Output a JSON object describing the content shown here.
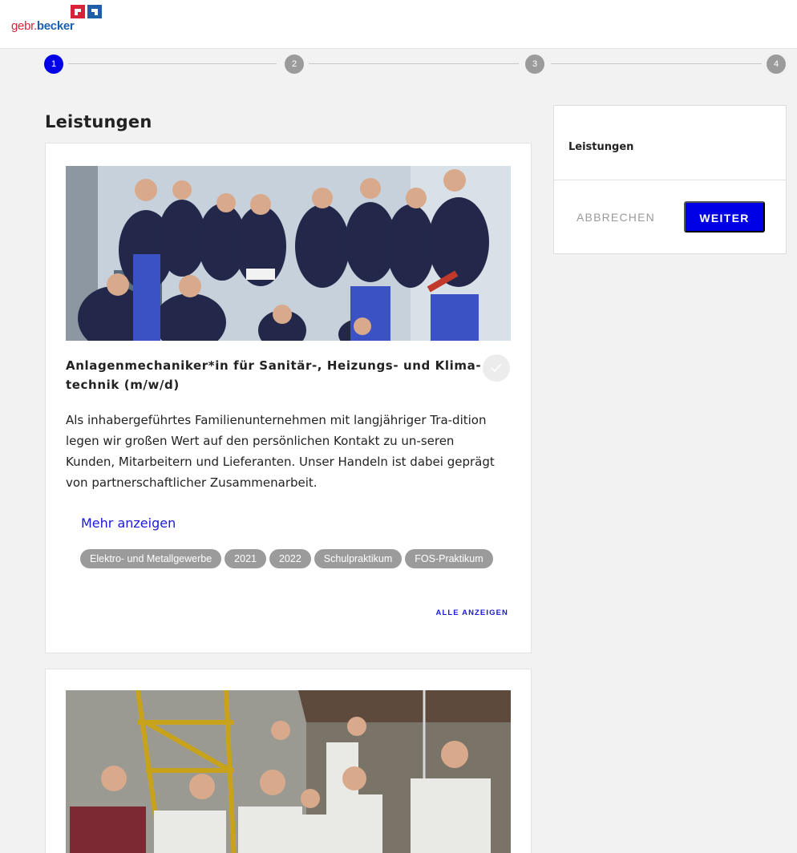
{
  "brand": {
    "name_prefix": "gebr.",
    "name_main": "becker",
    "colors": {
      "red": "#d6233a",
      "blue": "#1f5fa8"
    }
  },
  "stepper": {
    "steps": [
      {
        "label": "1",
        "active": true
      },
      {
        "label": "2",
        "active": false
      },
      {
        "label": "3",
        "active": false
      },
      {
        "label": "4",
        "active": false
      }
    ]
  },
  "main": {
    "title": "Leistungen",
    "cards": [
      {
        "image": "team-photo-workshop",
        "title": "Anlagenmechaniker*in für Sanitär-, Heizungs- und Klima-technik (m/w/d)",
        "description": "Als inhabergeführtes Familienunternehmen mit langjähriger Tra-dition legen wir großen Wert auf den persönlichen Kontakt zu un-seren Kunden, Mitarbeitern und Lieferanten. Unser Handeln ist dabei geprägt von partnerschaftlicher Zusammenarbeit.",
        "more_label": "Mehr anzeigen",
        "tags": [
          "Elektro- und Metallgewerbe",
          "2021",
          "2022",
          "Schulpraktikum",
          "FOS-Praktikum"
        ],
        "show_all_label": "ALLE ANZEIGEN",
        "selected": false
      },
      {
        "image": "team-photo-outdoor"
      }
    ]
  },
  "sidebar": {
    "title": "Leistungen",
    "cancel_label": "ABBRECHEN",
    "next_label": "WEITER"
  },
  "colors": {
    "accent": "#0000e6",
    "link": "#1a1ad6",
    "tag_bg": "#9b9b9b",
    "page_bg": "#f2f2f2"
  },
  "icons": {
    "check": "check-icon"
  }
}
